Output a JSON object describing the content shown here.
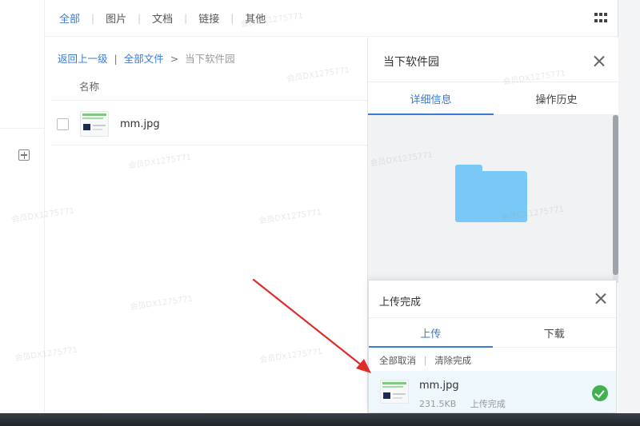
{
  "type_tabs": {
    "items": [
      {
        "label": "全部"
      },
      {
        "label": "图片"
      },
      {
        "label": "文档"
      },
      {
        "label": "链接"
      },
      {
        "label": "其他"
      }
    ],
    "active_index": 0
  },
  "breadcrumb": {
    "back_label": "返回上一级",
    "all_files_label": "全部文件",
    "separator": ">",
    "current_label": "当下软件园"
  },
  "file_list": {
    "column_name_label": "名称",
    "rows": [
      {
        "name": "mm.jpg",
        "icon": "image-thumbnail"
      }
    ]
  },
  "detail_panel": {
    "title": "当下软件园",
    "tabs": [
      {
        "label": "详细信息"
      },
      {
        "label": "操作历史"
      }
    ],
    "active_tab_index": 0,
    "preview_icon": "folder-icon"
  },
  "upload_panel": {
    "title": "上传完成",
    "tabs": [
      {
        "label": "上传"
      },
      {
        "label": "下载"
      }
    ],
    "active_tab_index": 0,
    "actions": {
      "cancel_all_label": "全部取消",
      "clear_done_label": "清除完成"
    },
    "items": [
      {
        "name": "mm.jpg",
        "size": "231.5KB",
        "status": "上传完成",
        "status_icon": "check-circle-icon"
      }
    ]
  },
  "watermark": "会员DX1275771",
  "colors": {
    "accent": "#3a7bd5",
    "folder": "#79c8f7",
    "success": "#43b050",
    "annotation_arrow": "#e02b2b"
  }
}
